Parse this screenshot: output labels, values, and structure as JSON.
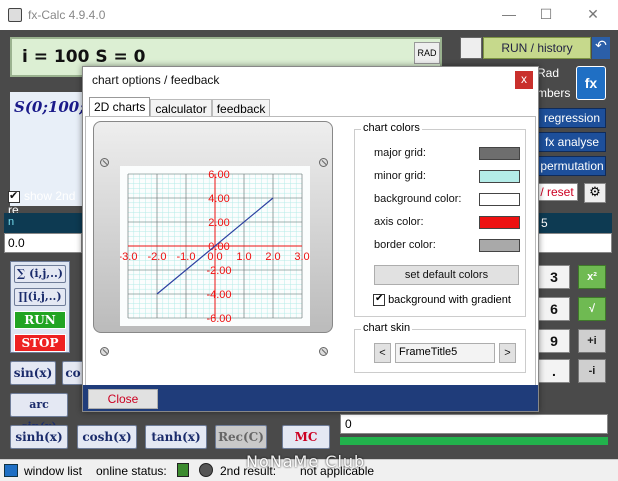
{
  "window": {
    "title": "fx-Calc 4.9.4.0",
    "minimize_glyph": "—",
    "maximize_glyph": "☐",
    "close_glyph": "✕"
  },
  "display": {
    "expression": "i = 100 S = 0",
    "mode": "RAD",
    "formula": "S(0;100;f(",
    "show_2nd_label": "show 2nd re",
    "n_label": "n",
    "n_value": "5",
    "value": "0.0"
  },
  "right_panel": {
    "run_history": "RUN / history",
    "rad_partial": "Rad",
    "numbers_partial": "mbers",
    "regression": "regression",
    "fx_analyse": "fx analyse",
    "permutation": "permutation",
    "reset_partial": "/ reset",
    "result_label": "0"
  },
  "buttons": {
    "sum": "∑ (i,j,..)",
    "prod": "∏(i,j,..)",
    "run": "RUN",
    "stop": "STOP",
    "sin": "sin(x)",
    "co_partial": "co",
    "arcsin": "arc sin(x)",
    "sinh": "sinh(x)",
    "cosh": "cosh(x)",
    "tanh": "tanh(x)",
    "rec": "Rec(C)",
    "mc": "MC",
    "num3": "3",
    "num6": "6",
    "num9": "9",
    "dot": ".",
    "plus_i": "+i",
    "minus_i": "-i"
  },
  "status": {
    "window_list": "window list",
    "online_status": "online status:",
    "second_result": "2nd result:",
    "not_applicable": "not applicable",
    "watermark": "NoNaMe Club"
  },
  "dialog": {
    "title": "chart options / feedback",
    "close_x": "x",
    "tabs": [
      "2D charts",
      "calculator",
      "feedback"
    ],
    "chart_colors_title": "chart colors",
    "rows": [
      {
        "label": "major grid:",
        "color": "#6e6e6e"
      },
      {
        "label": "minor grid:",
        "color": "#b4ece8"
      },
      {
        "label": "background color:",
        "color": "#ffffff"
      },
      {
        "label": "axis color:",
        "color": "#ee1111"
      },
      {
        "label": "border color:",
        "color": "#a9a9a9"
      }
    ],
    "set_default": "set default colors",
    "bg_gradient": "background with gradient",
    "chart_skin_title": "chart skin",
    "skin_value": "FrameTitle5",
    "prev": "<",
    "next": ">",
    "close_button": "Close"
  },
  "chart_data": {
    "type": "line",
    "x": [
      -2.0,
      2.0
    ],
    "series": [
      {
        "values": [
          -4.0,
          4.0
        ]
      }
    ],
    "xlim": [
      -3.0,
      3.0
    ],
    "ylim": [
      -6.0,
      6.0
    ],
    "x_ticks": [
      "-3.0",
      "-2.0",
      "-1.0",
      "0.0",
      "1.0",
      "2.0",
      "3.0"
    ],
    "y_ticks": [
      "6.00",
      "4.00",
      "2.00",
      "0.00",
      "-2.00",
      "-4.00",
      "-6.00"
    ],
    "grid": true
  }
}
